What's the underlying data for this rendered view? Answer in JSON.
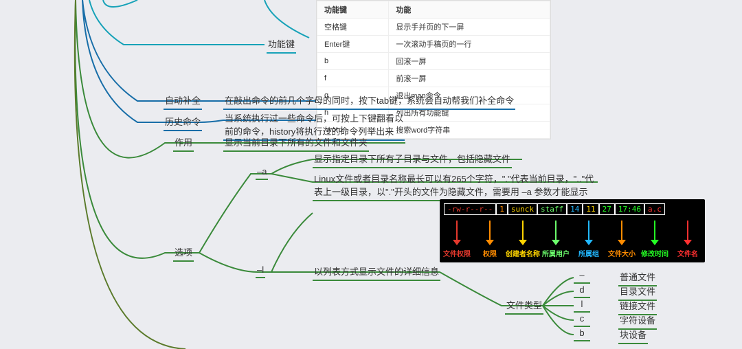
{
  "colors": {
    "teal": "#17a2b8",
    "blue": "#186ea8",
    "green": "#3a8a3a",
    "olive": "#5a7a2a"
  },
  "nodes": {
    "func_keys": "功能键",
    "auto_complete": "自动补全",
    "auto_complete_desc": "在敲出命令的前几个字母的同时，按下tab键，系统会自动帮我们补全命令",
    "history": "历史命令",
    "history_desc": "当系统执行过一些命令后，可按上下键翻看以\n前的命令，history将执行过的命令列举出来",
    "role": "作用",
    "role_desc": "显示当前目录下所有的文件和文件夹",
    "options": "选项",
    "opt_a": "–a",
    "opt_a_desc1": "显示指定目录下所有子目录与文件，包括隐藏文件",
    "opt_a_desc2": "Linux文件或者目录名称最长可以有265个字符，\".\"代表当前目录，\"..\"代\n表上一级目录，以\".\"开头的文件为隐藏文件，需要用 –a 参数才能显示",
    "opt_l": "–l",
    "opt_l_desc": "以列表方式显示文件的详细信息",
    "file_type": "文件类型",
    "ft_dash_k": "–",
    "ft_dash_v": "普通文件",
    "ft_d_k": "d",
    "ft_d_v": "目录文件",
    "ft_l_k": "l",
    "ft_l_v": "链接文件",
    "ft_c_k": "c",
    "ft_c_v": "字符设备",
    "ft_b_k": "b",
    "ft_b_v": "块设备"
  },
  "func_table": {
    "headers": [
      "功能键",
      "功能"
    ],
    "rows": [
      [
        "空格键",
        "显示手并页的下一屏"
      ],
      [
        "Enter键",
        "一次滚动手稿页的一行"
      ],
      [
        "b",
        "回滚一屏"
      ],
      [
        "f",
        "前滚一屏"
      ],
      [
        "q",
        "退出man命令"
      ],
      [
        "h",
        "列出所有功能键"
      ],
      [
        "/word",
        "搜索word字符串"
      ]
    ]
  },
  "ls_diagram": {
    "segments": [
      {
        "text": "-rw-r--r--",
        "color": "#e5392d"
      },
      {
        "text": "1",
        "color": "#ff8c00"
      },
      {
        "text": "sunck",
        "color": "#ffd400"
      },
      {
        "text": "staff",
        "color": "#6cff6c"
      },
      {
        "text": "14",
        "color": "#22b8ff"
      },
      {
        "text": "11",
        "color": "#ffd400"
      },
      {
        "text": "27",
        "color": "#24ff24"
      },
      {
        "text": "17:46",
        "color": "#24ff24"
      },
      {
        "text": "a.c",
        "color": "#ff3030"
      }
    ],
    "arrows": [
      {
        "color": "#e5392d",
        "label": "文件权限"
      },
      {
        "color": "#ff8c00",
        "label": "权限"
      },
      {
        "color": "#ffd400",
        "label": "创建者名称"
      },
      {
        "color": "#6cff6c",
        "label": "所属用户"
      },
      {
        "color": "#22b8ff",
        "label": "所属组"
      },
      {
        "color": "#ff8c00",
        "label": "文件大小"
      },
      {
        "color": "#24ff24",
        "label": "修改时间"
      },
      {
        "color": "#ff3030",
        "label": "文件名"
      }
    ]
  }
}
